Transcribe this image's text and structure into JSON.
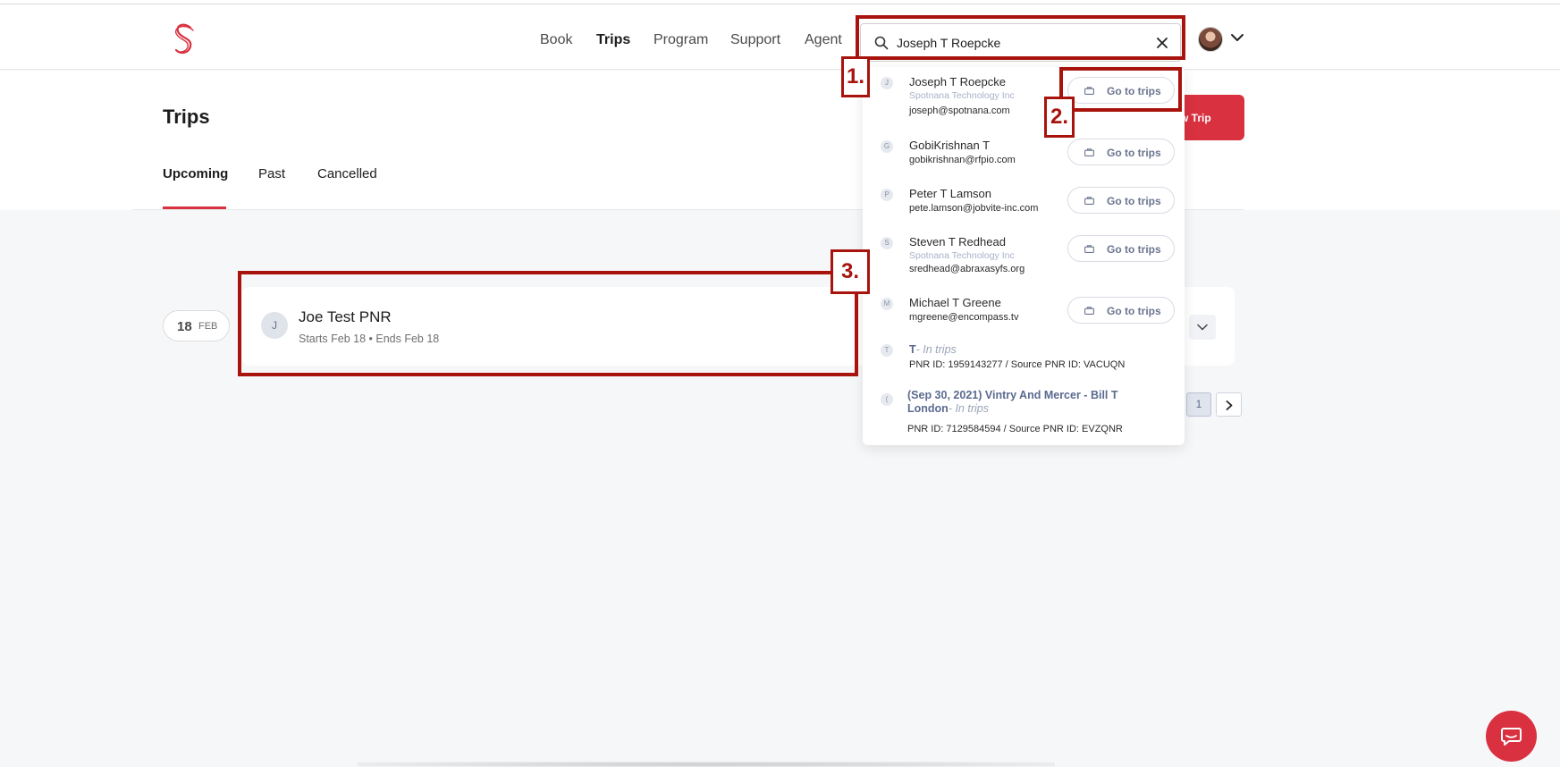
{
  "header": {
    "nav": [
      "Book",
      "Trips",
      "Program",
      "Support",
      "Agent"
    ],
    "active_nav": "Trips"
  },
  "search": {
    "value": "Joseph T Roepcke"
  },
  "page": {
    "title": "Trips",
    "new_trip_label": "w Trip",
    "tabs": [
      "Upcoming",
      "Past",
      "Cancelled"
    ],
    "active_tab": "Upcoming"
  },
  "trip": {
    "day": "18",
    "month": "FEB",
    "avatar_initial": "J",
    "name": "Joe Test PNR",
    "dates": "Starts Feb 18  •  Ends Feb 18"
  },
  "pagination": {
    "current_page": "1"
  },
  "dropdown": {
    "go_label": "Go to trips",
    "users": [
      {
        "initial": "J",
        "name": "Joseph T Roepcke",
        "company": "Spotnana Technology Inc",
        "email": "joseph@spotnana.com"
      },
      {
        "initial": "G",
        "name": "GobiKrishnan T",
        "company": "",
        "email": "gobikrishnan@rfpio.com"
      },
      {
        "initial": "P",
        "name": "Peter T Lamson",
        "company": "",
        "email": "pete.lamson@jobvite-inc.com"
      },
      {
        "initial": "S",
        "name": "Steven T Redhead",
        "company": "Spotnana Technology Inc",
        "email": "sredhead@abraxasyfs.org"
      },
      {
        "initial": "M",
        "name": "Michael T Greene",
        "company": "",
        "email": "mgreene@encompass.tv"
      }
    ],
    "trips": [
      {
        "initial": "T",
        "title": "T",
        "suffix": "- In trips",
        "pnr": "PNR ID: 1959143277 / Source PNR ID: VACUQN"
      },
      {
        "initial": "(",
        "title": "(Sep 30, 2021) Vintry And Mercer - Bill T London",
        "suffix": "- In trips",
        "pnr": "PNR ID: 7129584594 / Source PNR ID: EVZQNR"
      }
    ]
  },
  "annotations": [
    "1.",
    "2.",
    "3."
  ],
  "colors": {
    "brand_red": "#d9313f",
    "annotation_red": "#a8140d",
    "link_blue_gray": "#5a6a8f"
  }
}
